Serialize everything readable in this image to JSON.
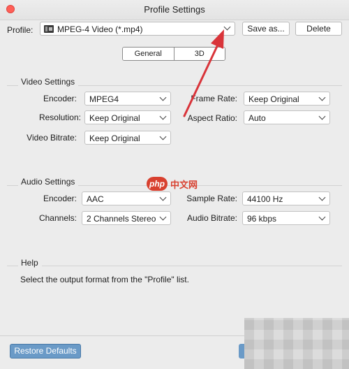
{
  "window": {
    "title": "Profile Settings"
  },
  "profile": {
    "label": "Profile:",
    "value": "MPEG-4 Video (*.mp4)",
    "save_label": "Save as...",
    "delete_label": "Delete"
  },
  "tabs": [
    {
      "label": "General",
      "selected": true
    },
    {
      "label": "3D",
      "selected": false
    }
  ],
  "video": {
    "title": "Video Settings",
    "encoder_label": "Encoder:",
    "encoder_value": "MPEG4",
    "resolution_label": "Resolution:",
    "resolution_value": "Keep Original",
    "bitrate_label": "Video Bitrate:",
    "bitrate_value": "Keep Original",
    "framerate_label": "Frame Rate:",
    "framerate_value": "Keep Original",
    "aspect_label": "Aspect Ratio:",
    "aspect_value": "Auto"
  },
  "audio": {
    "title": "Audio Settings",
    "encoder_label": "Encoder:",
    "encoder_value": "AAC",
    "channels_label": "Channels:",
    "channels_value": "2 Channels Stereo",
    "samplerate_label": "Sample Rate:",
    "samplerate_value": "44100 Hz",
    "bitrate_label": "Audio Bitrate:",
    "bitrate_value": "96 kbps"
  },
  "help": {
    "title": "Help",
    "text": "Select the output format from the \"Profile\" list."
  },
  "footer": {
    "restore_label": "Restore Defaults"
  },
  "watermark": {
    "logo": "php",
    "text": "中文网"
  },
  "colors": {
    "accent": "#6a9ac7",
    "arrow": "#d9343a",
    "close": "#ff5f57"
  }
}
